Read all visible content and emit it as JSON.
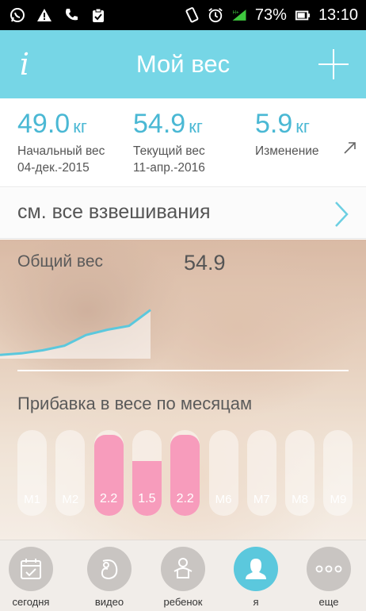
{
  "status_bar": {
    "network": "H+",
    "battery": "73%",
    "time": "13:10",
    "left_icons": [
      "whatsapp-icon",
      "warning-icon",
      "phone-icon",
      "clipboard-check-icon"
    ],
    "right_icons": [
      "vibrate-icon",
      "alarm-icon",
      "signal-icon",
      "battery-icon"
    ]
  },
  "header": {
    "info_label": "i",
    "title": "Мой вес"
  },
  "stats": {
    "unit": "кг",
    "initial": {
      "value": "49.0",
      "label": "Начальный вес",
      "date": "04-дек.-2015"
    },
    "current": {
      "value": "54.9",
      "label": "Текущий вес",
      "date": "11-апр.-2016"
    },
    "change": {
      "value": "5.9",
      "label": "Изменение"
    }
  },
  "see_all": {
    "label": "см. все взвешивания"
  },
  "total": {
    "label": "Общий вес",
    "value": "54.9"
  },
  "chart_data": {
    "type": "area",
    "title": "Общий вес",
    "x": [
      0,
      1,
      2,
      3,
      4,
      5,
      6,
      7
    ],
    "values": [
      49.0,
      49.2,
      49.6,
      50.2,
      51.6,
      52.3,
      52.8,
      54.9
    ],
    "ylim": [
      48.5,
      56
    ],
    "grid": false,
    "color": "#5bc8dd"
  },
  "monthly": {
    "title": "Прибавка в весе по месяцам",
    "months": [
      {
        "label": "M1",
        "value": null
      },
      {
        "label": "M2",
        "value": null
      },
      {
        "label": "2.2",
        "value": 2.2
      },
      {
        "label": "1.5",
        "value": 1.5
      },
      {
        "label": "2.2",
        "value": 2.2
      },
      {
        "label": "M6",
        "value": null
      },
      {
        "label": "M7",
        "value": null
      },
      {
        "label": "M8",
        "value": null
      },
      {
        "label": "M9",
        "value": null
      }
    ],
    "max_value": 2.2,
    "fill_color": "#f79cbc"
  },
  "tabs": [
    {
      "label": "сегодня",
      "icon": "calendar-check-icon"
    },
    {
      "label": "видео",
      "icon": "baby-embryo-icon"
    },
    {
      "label": "ребенок",
      "icon": "baby-icon"
    },
    {
      "label": "я",
      "icon": "person-icon",
      "active": true
    },
    {
      "label": "еще",
      "icon": "more-dots-icon"
    }
  ],
  "colors": {
    "accent": "#76d6e6",
    "value_blue": "#4ab8d4",
    "pink": "#f79cbc"
  }
}
